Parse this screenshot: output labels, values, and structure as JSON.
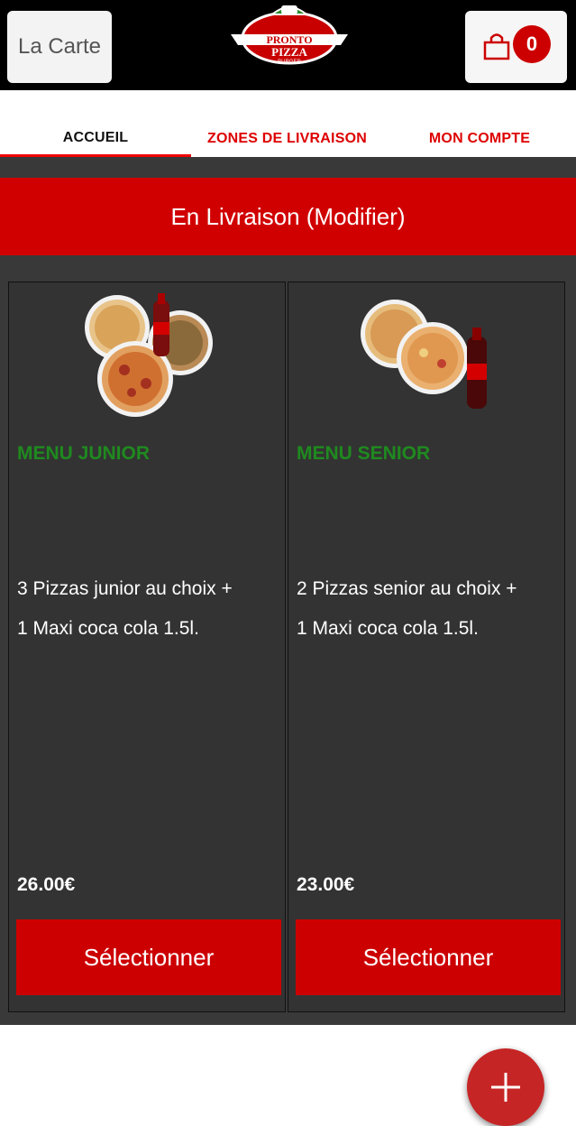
{
  "header": {
    "carte_label": "La Carte",
    "cart_count": "0",
    "logo_top": "PRONTO",
    "logo_main": "PIZZA",
    "logo_sub": "BURGER"
  },
  "tabs": [
    {
      "label": "ACCUEIL"
    },
    {
      "label": "ZONES DE LIVRAISON"
    },
    {
      "label": "MON COMPTE"
    }
  ],
  "delivery_bar": {
    "label": "En Livraison (Modifier)"
  },
  "cards": [
    {
      "title": "MENU JUNIOR",
      "desc": "3 Pizzas junior au choix  +\n1 Maxi coca cola 1.5l.",
      "price": "26.00€",
      "button": "Sélectionner"
    },
    {
      "title": "MENU SENIOR",
      "desc": "2 Pizzas senior au choix  +\n1 Maxi coca cola 1.5l.",
      "price": "23.00€",
      "button": "Sélectionner"
    }
  ],
  "colors": {
    "brand_red": "#cc0000",
    "title_green": "#1f8a1f",
    "background_dark": "#393939"
  },
  "icons": {
    "cart": "shopping-bag-icon",
    "fab": "plus-icon"
  }
}
